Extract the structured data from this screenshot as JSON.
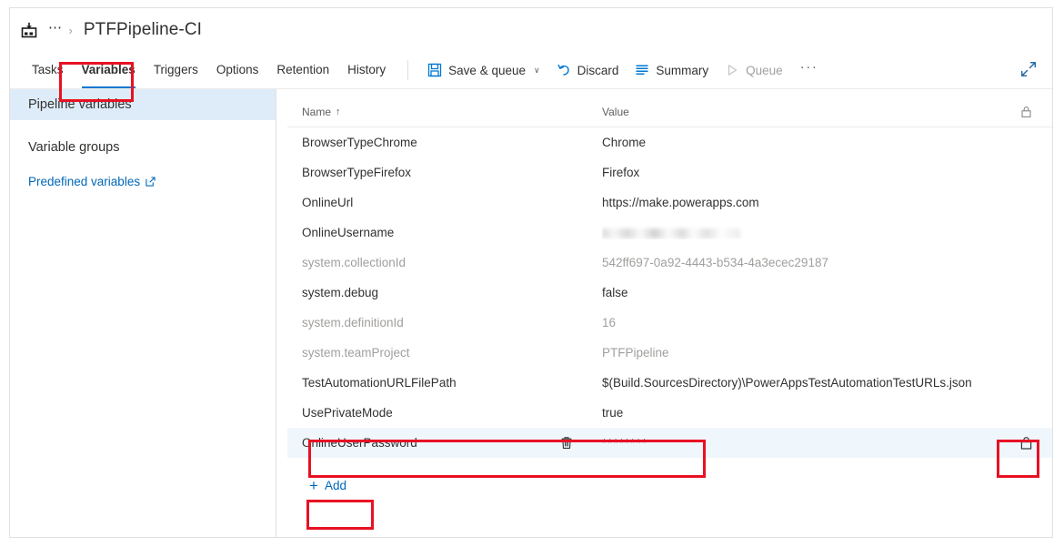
{
  "header": {
    "pipeline_icon": "build-pipeline-icon",
    "breadcrumb_ellipsis": "⋯",
    "breadcrumb_chevron": "›",
    "title": "PTFPipeline-CI"
  },
  "toolbar": {
    "tabs": [
      {
        "label": "Tasks",
        "selected": false
      },
      {
        "label": "Variables",
        "selected": true
      },
      {
        "label": "Triggers",
        "selected": false
      },
      {
        "label": "Options",
        "selected": false
      },
      {
        "label": "Retention",
        "selected": false
      },
      {
        "label": "History",
        "selected": false
      }
    ],
    "save_and_queue": {
      "label": "Save & queue",
      "icon": "save-icon",
      "chevron": "∨"
    },
    "discard": {
      "label": "Discard",
      "icon": "undo-icon"
    },
    "summary": {
      "label": "Summary",
      "icon": "list-icon"
    },
    "queue": {
      "label": "Queue",
      "icon": "play-icon",
      "disabled": true
    },
    "overflow": "···",
    "expand": "expand-icon"
  },
  "sidebar": {
    "items": [
      {
        "label": "Pipeline variables",
        "selected": true
      },
      {
        "label": "Variable groups",
        "selected": false
      }
    ],
    "link": {
      "label": "Predefined variables",
      "icon": "external-link-icon"
    }
  },
  "grid": {
    "columns": {
      "name": "Name",
      "sort_indicator": "↑",
      "value": "Value",
      "lock": "lock-icon"
    },
    "rows": [
      {
        "name": "BrowserTypeChrome",
        "value": "Chrome",
        "readonly": false,
        "selected": false,
        "masked": false
      },
      {
        "name": "BrowserTypeFirefox",
        "value": "Firefox",
        "readonly": false,
        "selected": false,
        "masked": false
      },
      {
        "name": "OnlineUrl",
        "value": "https://make.powerapps.com",
        "readonly": false,
        "selected": false,
        "masked": false
      },
      {
        "name": "OnlineUsername",
        "value": "",
        "readonly": false,
        "selected": false,
        "masked": false,
        "redacted": true
      },
      {
        "name": "system.collectionId",
        "value": "542ff697-0a92-4443-b534-4a3ecec29187",
        "readonly": true,
        "selected": false,
        "masked": false
      },
      {
        "name": "system.debug",
        "value": "false",
        "readonly": false,
        "selected": false,
        "masked": false
      },
      {
        "name": "system.definitionId",
        "value": "16",
        "readonly": true,
        "selected": false,
        "masked": false
      },
      {
        "name": "system.teamProject",
        "value": "PTFPipeline",
        "readonly": true,
        "selected": false,
        "masked": false
      },
      {
        "name": "TestAutomationURLFilePath",
        "value": "$(Build.SourcesDirectory)\\PowerAppsTestAutomationTestURLs.json",
        "readonly": false,
        "selected": false,
        "masked": false
      },
      {
        "name": "UsePrivateMode",
        "value": "true",
        "readonly": false,
        "selected": false,
        "masked": false
      },
      {
        "name": "OnlineUserPassword",
        "value": "********",
        "readonly": false,
        "selected": true,
        "masked": true,
        "delete_icon": "trash-icon",
        "lock_icon": "lock-closed-icon"
      }
    ],
    "add_button": {
      "label": "Add",
      "plus": "+"
    }
  },
  "annotations": {
    "color": "#e81123",
    "boxes": [
      {
        "name": "variables-tab-highlight"
      },
      {
        "name": "password-row-highlight"
      },
      {
        "name": "lock-cell-highlight"
      },
      {
        "name": "add-button-highlight"
      }
    ]
  }
}
